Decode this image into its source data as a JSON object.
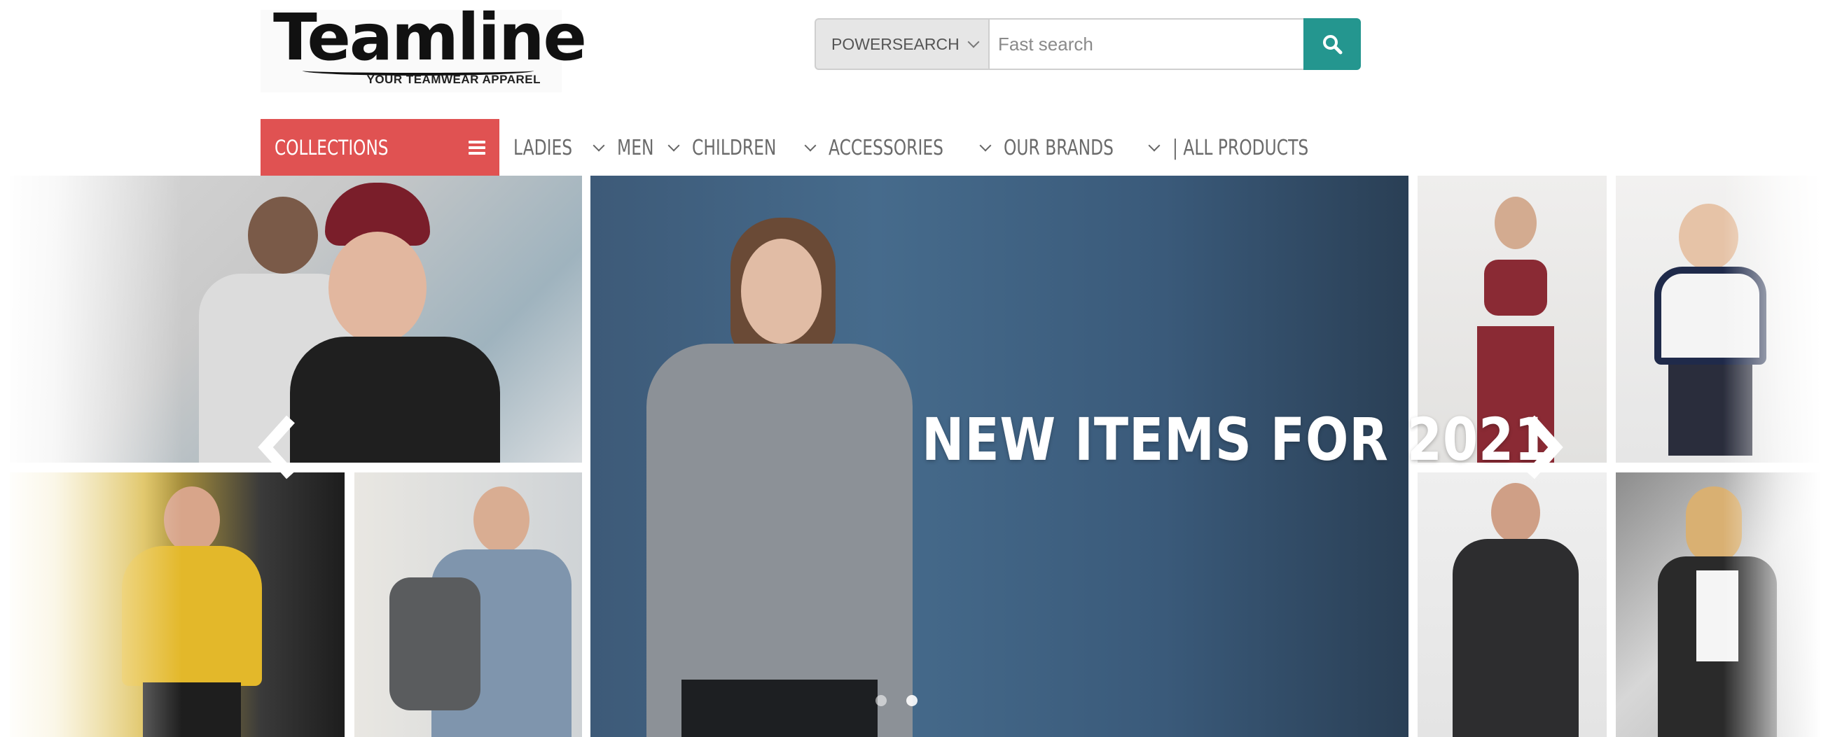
{
  "header": {
    "logo": {
      "wordmark": "Teamline",
      "tagline": "YOUR TEAMWEAR APPAREL"
    },
    "search": {
      "mode_label": "POWERSEARCH",
      "placeholder": "Fast search",
      "value": ""
    }
  },
  "nav": {
    "collections_label": "COLLECTIONS",
    "items": [
      {
        "label": "LADIES",
        "dropdown": true
      },
      {
        "label": "MEN",
        "dropdown": true
      },
      {
        "label": "CHILDREN",
        "dropdown": true
      },
      {
        "label": "ACCESSORIES",
        "dropdown": true
      },
      {
        "label": "OUR BRANDS",
        "dropdown": true
      },
      {
        "label": "| ALL PRODUCTS",
        "dropdown": false
      }
    ]
  },
  "banner": {
    "title": "NEW ITEMS FOR 2021",
    "slide_count": 2,
    "active_slide": 1
  },
  "colors": {
    "accent_red": "#e05252",
    "accent_teal": "#24968f",
    "nav_text": "#6b6b6b"
  },
  "icons": {
    "search_button": "search-icon",
    "collections": "hamburger-icon",
    "prev": "chevron-left-icon",
    "next": "chevron-right-icon"
  }
}
